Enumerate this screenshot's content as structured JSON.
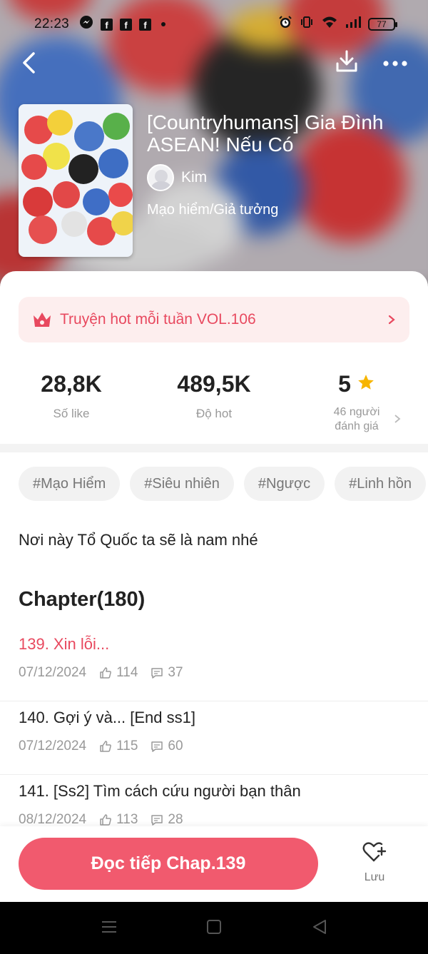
{
  "status_bar": {
    "time": "22:23",
    "battery": "77",
    "icons": [
      "messenger-icon",
      "facebook-icon",
      "facebook-icon",
      "facebook-icon",
      "notification-dot",
      "alarm-icon",
      "vibrate-icon",
      "wifi-icon",
      "signal-icon",
      "battery-icon"
    ]
  },
  "nav": {
    "back_icon": "back-arrow-icon",
    "download_icon": "download-icon",
    "more_icon": "more-dots-icon"
  },
  "book": {
    "title": "[Countryhumans] Gia Đình ASEAN! Nếu Có",
    "author": "Kim",
    "genre": "Mạo hiểm/Giả tưởng"
  },
  "hot_banner": {
    "text": "Truyện hot mỗi tuần VOL.106",
    "icon": "crown-icon"
  },
  "stats": {
    "likes": {
      "value": "28,8K",
      "label": "Số like"
    },
    "hot": {
      "value": "489,5K",
      "label": "Độ hot"
    },
    "rating": {
      "value": "5",
      "label_line1": "46 người",
      "label_line2": "đánh giá"
    }
  },
  "tags": [
    "#Mạo Hiểm",
    "#Siêu nhiên",
    "#Ngược",
    "#Linh hồn"
  ],
  "description": "Nơi này Tổ Quốc ta sẽ là nam nhé",
  "chapter_heading": "Chapter(180)",
  "chapters": [
    {
      "title": "139. Xin lỗi...",
      "date": "07/12/2024",
      "likes": "114",
      "comments": "37"
    },
    {
      "title": "140. Gợi ý và... [End ss1]",
      "date": "07/12/2024",
      "likes": "115",
      "comments": "60"
    },
    {
      "title": "141. [Ss2] Tìm cách cứu người bạn thân",
      "date": "08/12/2024",
      "likes": "113",
      "comments": "28"
    }
  ],
  "bottom_bar": {
    "continue_label": "Đọc tiếp Chap.139",
    "save_label": "Lưu"
  },
  "colors": {
    "accent": "#f15a6e",
    "accent_text": "#e8495f",
    "banner_bg": "#fdeeee",
    "star": "#f7b500"
  }
}
